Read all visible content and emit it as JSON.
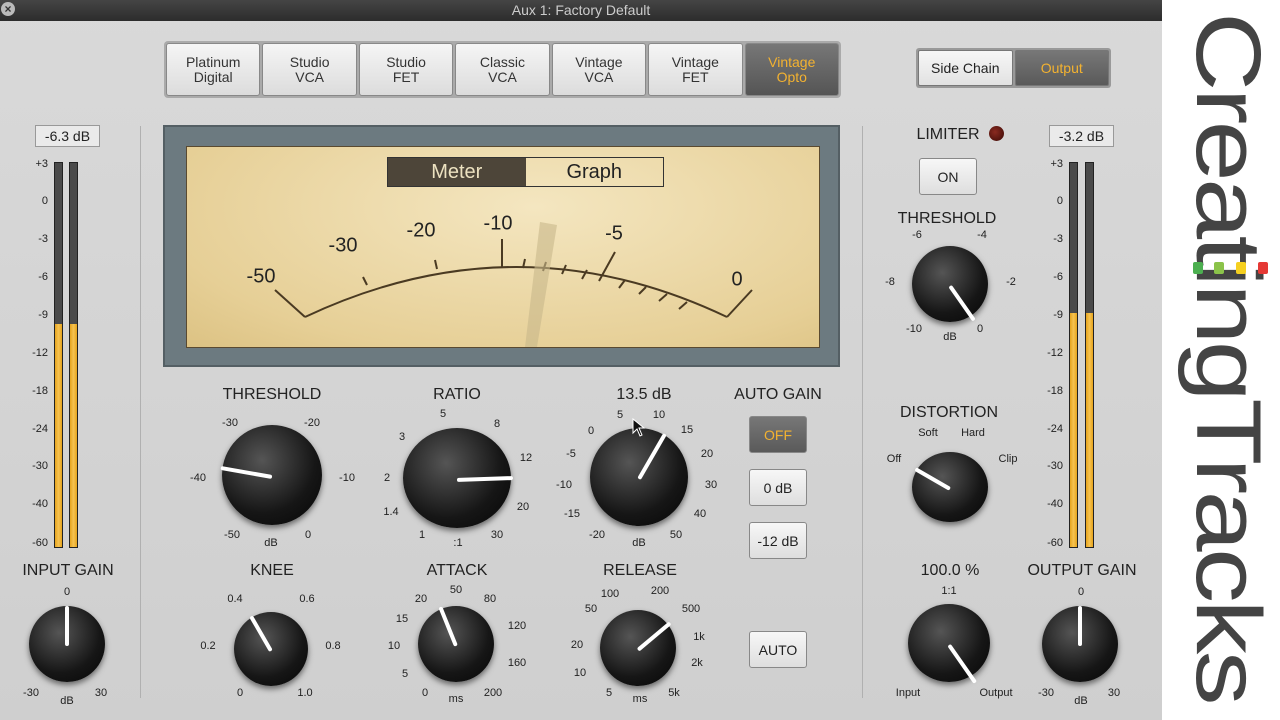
{
  "window": {
    "title": "Aux 1: Factory Default",
    "close_icon": "close-icon"
  },
  "models": [
    {
      "label": "Platinum\nDigital",
      "active": false
    },
    {
      "label": "Studio\nVCA",
      "active": false
    },
    {
      "label": "Studio\nFET",
      "active": false
    },
    {
      "label": "Classic\nVCA",
      "active": false
    },
    {
      "label": "Vintage\nVCA",
      "active": false
    },
    {
      "label": "Vintage\nFET",
      "active": false
    },
    {
      "label": "Vintage\nOpto",
      "active": true
    }
  ],
  "view_tabs": {
    "side_chain": "Side Chain",
    "output": "Output",
    "active": "Output"
  },
  "input_meter": {
    "readout": "-6.3 dB",
    "scale": [
      "+3",
      "0",
      "-3",
      "-6",
      "-9",
      "-12",
      "-18",
      "-24",
      "-30",
      "-40",
      "-60"
    ],
    "level_fraction": 0.58
  },
  "output_meter": {
    "readout": "-3.2 dB",
    "scale": [
      "+3",
      "0",
      "-3",
      "-6",
      "-9",
      "-12",
      "-18",
      "-24",
      "-30",
      "-40",
      "-60"
    ],
    "level_fraction": 0.61
  },
  "meter": {
    "tabs": {
      "meter": "Meter",
      "graph": "Graph",
      "active": "Meter"
    },
    "scale": [
      "-50",
      "-30",
      "-20",
      "-10",
      "-5",
      "0"
    ],
    "needle_value": "-7"
  },
  "controls": {
    "threshold": {
      "label": "THRESHOLD",
      "ticks": [
        "-30",
        "-20",
        "-40",
        "-10",
        "-50",
        "0"
      ],
      "unit": "dB"
    },
    "ratio": {
      "label": "RATIO",
      "ticks": [
        "5",
        "8",
        "3",
        "12",
        "2",
        "20",
        "1.4",
        "30",
        "1"
      ],
      "unit": ":1"
    },
    "makeup": {
      "label": "13.5 dB",
      "ticks": [
        "5",
        "10",
        "0",
        "15",
        "-5",
        "20",
        "-10",
        "30",
        "-15",
        "40",
        "-20",
        "50"
      ],
      "unit": "dB"
    },
    "knee": {
      "label": "KNEE",
      "ticks": [
        "0.4",
        "0.6",
        "0.2",
        "0.8",
        "0",
        "1.0"
      ]
    },
    "attack": {
      "label": "ATTACK",
      "ticks": [
        "50",
        "20",
        "80",
        "15",
        "120",
        "10",
        "5",
        "160",
        "0",
        "200"
      ],
      "unit": "ms"
    },
    "release": {
      "label": "RELEASE",
      "ticks": [
        "100",
        "200",
        "50",
        "500",
        "20",
        "1k",
        "10",
        "2k",
        "5",
        "5k"
      ],
      "unit": "ms"
    },
    "input_gain": {
      "label": "INPUT GAIN",
      "ticks": [
        "0",
        "-30",
        "30"
      ],
      "unit": "dB"
    },
    "output_gain": {
      "label": "OUTPUT GAIN",
      "ticks": [
        "0",
        "-30",
        "30"
      ],
      "unit": "dB"
    },
    "limiter": {
      "label": "LIMITER",
      "button": "ON"
    },
    "limiter_threshold": {
      "label": "THRESHOLD",
      "ticks": [
        "-6",
        "-4",
        "-8",
        "-2",
        "-10",
        "0"
      ],
      "unit": "dB"
    },
    "distortion": {
      "label": "DISTORTION",
      "ticks": [
        "Soft",
        "Hard",
        "Off",
        "Clip"
      ]
    },
    "mix": {
      "label": "100.0 %",
      "ticks": [
        "1:1",
        "Input",
        "Output"
      ]
    }
  },
  "auto_gain": {
    "label": "AUTO GAIN",
    "options": [
      "OFF",
      "0 dB",
      "-12 dB"
    ],
    "active": "OFF",
    "auto_button": "AUTO"
  },
  "logo": {
    "text": "CreatingTracks"
  }
}
